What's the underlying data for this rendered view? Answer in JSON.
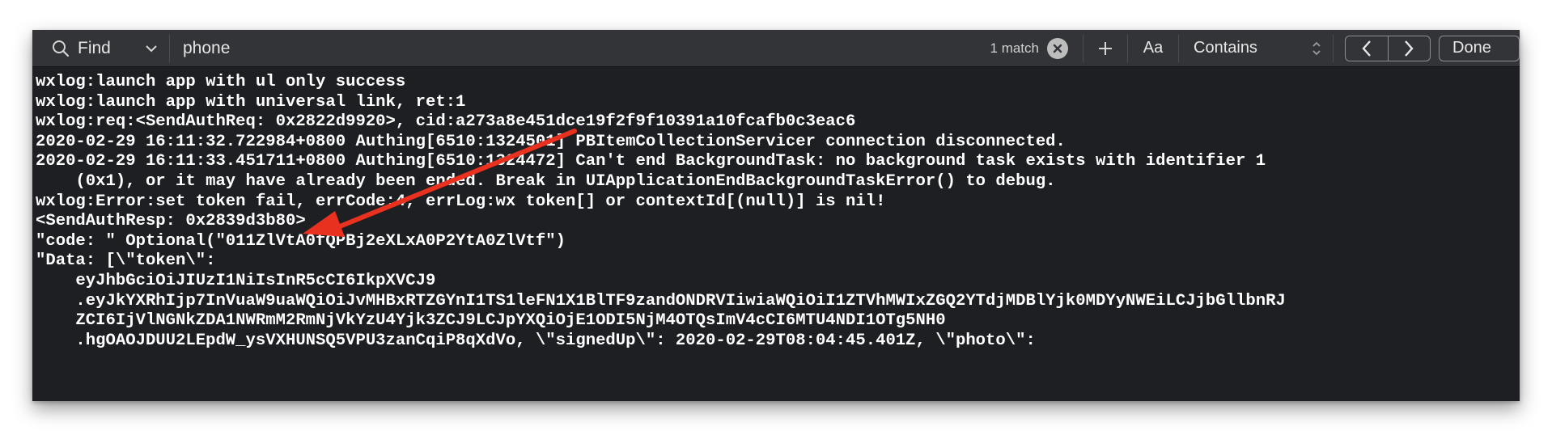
{
  "find_bar": {
    "mode_label": "Find",
    "query": "phone",
    "match_count": "1 match",
    "case_label": "Aa",
    "match_type": "Contains",
    "done_label": "Done"
  },
  "console": {
    "lines": [
      "wxlog:launch app with ul only success",
      "wxlog:launch app with universal link, ret:1",
      "wxlog:req:<SendAuthReq: 0x2822d9920>, cid:a273a8e451dce19f2f9f10391a10fcafb0c3eac6",
      "2020-02-29 16:11:32.722984+0800 Authing[6510:1324501] PBItemCollectionServicer connection disconnected.",
      "2020-02-29 16:11:33.451711+0800 Authing[6510:1324472] Can't end BackgroundTask: no background task exists with identifier 1",
      "    (0x1), or it may have already been ended. Break in UIApplicationEndBackgroundTaskError() to debug.",
      "wxlog:Error:set token fail, errCode:4, errLog:wx token[] or contextId[(null)] is nil!",
      "<SendAuthResp: 0x2839d3b80>",
      "\"code: \" Optional(\"011ZlVtA0fQPBj2eXLxA0P2YtA0ZlVtf\")",
      "\"Data: [\\\"token\\\":",
      "    eyJhbGciOiJIUzI1NiIsInR5cCI6IkpXVCJ9",
      "    .eyJkYXRhIjp7InVuaW9uaWQiOiJvMHBxRTZGYnI1TS1leFN1X1BlTF9zandONDRVIiwiaWQiOiI1ZTVhMWIxZGQ2YTdjMDBlYjk0MDYyNWEiLCJjbGllbnRJ",
      "    ZCI6IjVlNGNkZDA1NWRmM2RmNjVkYzU4Yjk3ZCJ9LCJpYXQiOjE1ODI5NjM4OTQsImV4cCI6MTU4NDI1OTg5NH0",
      "    .hgOAOJDUU2LEpdW_ysVXHUNSQ5VPU3zanCqiP8qXdVo, \\\"signedUp\\\": 2020-02-29T08:04:45.401Z, \\\"photo\\\":"
    ]
  },
  "annotation": {
    "arrow_color": "#e8321f"
  },
  "colors": {
    "console_bg": "#1e1f22",
    "findbar_bg": "#333437",
    "text": "#ffffff"
  }
}
